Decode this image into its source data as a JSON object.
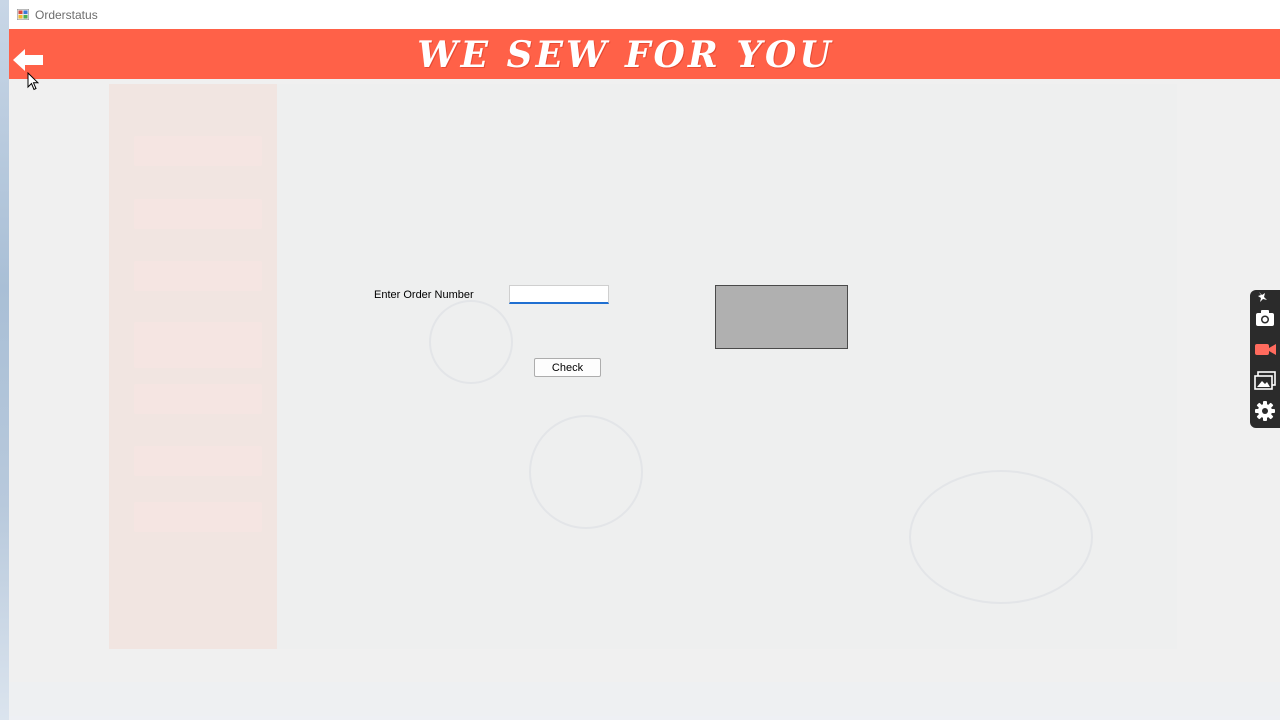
{
  "window": {
    "title": "Orderstatus"
  },
  "banner": {
    "title": "WE SEW FOR YOU",
    "color": "#ff6148"
  },
  "form": {
    "order_label": "Enter Order Number",
    "order_input_value": "",
    "check_label": "Check"
  },
  "icons": {
    "back": "arrow-left-icon",
    "app": "app-icon",
    "capture_tools": [
      "pin-icon",
      "camera-icon",
      "video-icon",
      "gallery-icon",
      "gear-icon"
    ]
  },
  "colors": {
    "banner": "#ff6148",
    "result_box": "#b0b0b0",
    "input_focus": "#1f6fd1",
    "toolbar_bg": "#2b2b2b",
    "video_icon": "#ff6b5e"
  }
}
